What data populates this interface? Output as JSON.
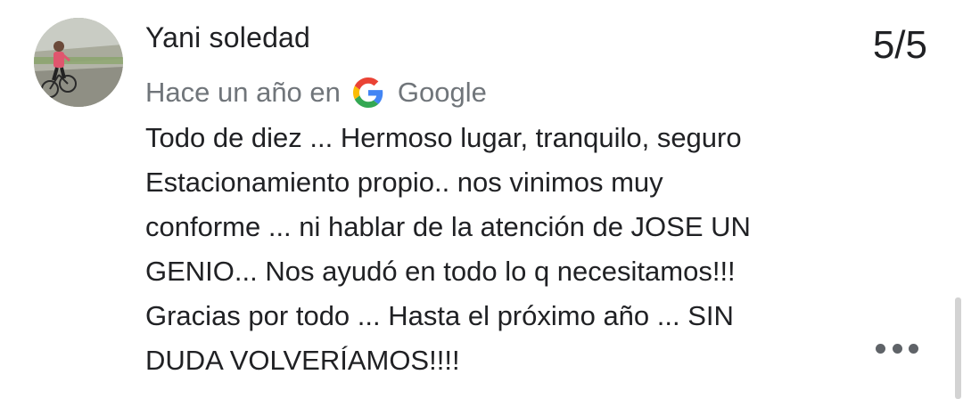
{
  "review": {
    "author_name": "Yani soledad",
    "rating": "5/5",
    "time_prefix": "Hace un año en",
    "source_name": "Google",
    "source_icon": "google-g-icon",
    "text_lines": [
      "Todo de diez ... Hermoso lugar, tranquilo, seguro",
      "Estacionamiento propio.. nos vinimos muy",
      "conforme ... ni hablar de la atención de JOSE UN",
      "GENIO... Nos ayudó en todo lo q necesitamos!!!",
      "Gracias por todo ... Hasta el próximo año ... SIN",
      "DUDA VOLVERÍAMOS!!!!"
    ],
    "more_icon": "more-horizontal-icon"
  },
  "colors": {
    "text_primary": "#202124",
    "text_secondary": "#70757a",
    "icon_gray": "#5f6368",
    "google_blue": "#4285F4",
    "google_red": "#EA4335",
    "google_yellow": "#FBBC05",
    "google_green": "#34A853"
  }
}
